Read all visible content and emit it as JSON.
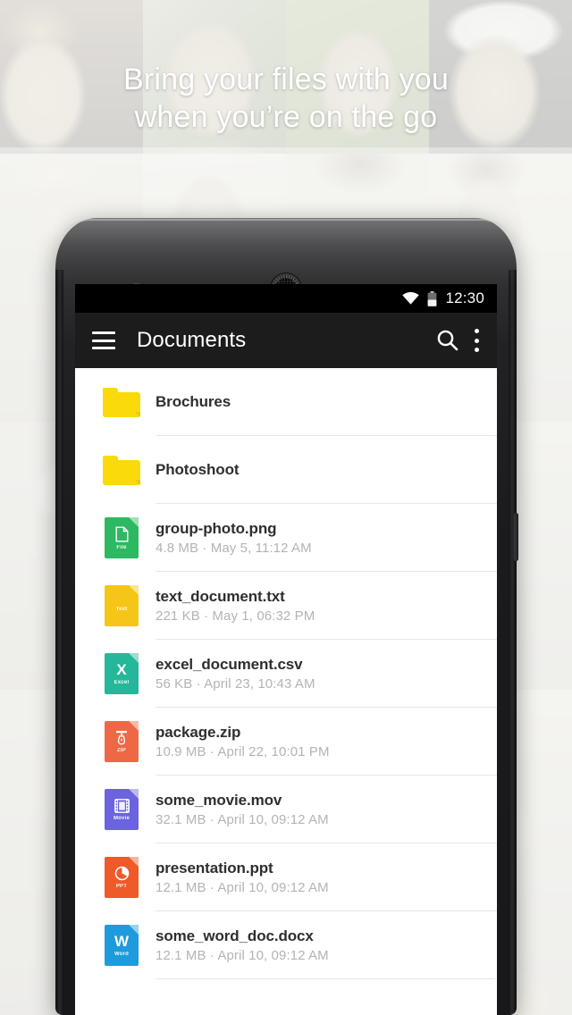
{
  "headline": {
    "line1": "Bring your files with you",
    "line2": "when you’re on the go"
  },
  "device": {
    "camera": "front-camera",
    "speaker": "earpiece-speaker"
  },
  "status_bar": {
    "wifi_icon": "wifi-icon",
    "battery_icon": "battery-icon",
    "time": "12:30"
  },
  "app_bar": {
    "menu_icon": "hamburger-menu-icon",
    "title": "Documents",
    "search_icon": "search-icon",
    "overflow_icon": "overflow-menu-icon"
  },
  "colors": {
    "status_bar_bg": "#000000",
    "app_bar_bg": "#1c1c1c",
    "screen_bg": "#ffffff",
    "folder": "#fada0a",
    "file_png": "#2db862",
    "file_txt": "#f5c518",
    "file_csv": "#25b79a",
    "file_zip": "#ef6845",
    "file_mov": "#6b63e0",
    "file_ppt": "#ef5a2a",
    "file_docx": "#1e9bdc",
    "primary_text": "#2e2e2e",
    "secondary_text": "#b4b4b4",
    "divider": "#e6e6e6"
  },
  "file_list": [
    {
      "type": "folder",
      "icon": "folder-icon",
      "name": "Brochures",
      "meta": ""
    },
    {
      "type": "folder",
      "icon": "folder-icon",
      "name": "Photoshoot",
      "meta": ""
    },
    {
      "type": "file",
      "icon": "file-png-icon",
      "tag": "File",
      "glyph": "page",
      "color": "#2db862",
      "name": "group-photo.png",
      "meta": "4.8 MB · May 5, 11:12 AM"
    },
    {
      "type": "file",
      "icon": "file-txt-icon",
      "tag": "Text",
      "glyph": "lines",
      "color": "#f5c518",
      "name": "text_document.txt",
      "meta": "221 KB · May 1, 06:32 PM"
    },
    {
      "type": "file",
      "icon": "file-csv-icon",
      "tag": "Excel",
      "glyph": "X",
      "color": "#25b79a",
      "name": "excel_document.csv",
      "meta": "56 KB · April 23, 10:43 AM"
    },
    {
      "type": "file",
      "icon": "file-zip-icon",
      "tag": "ZIP",
      "glyph": "zipper",
      "color": "#ef6845",
      "name": "package.zip",
      "meta": "10.9 MB · April 22, 10:01 PM"
    },
    {
      "type": "file",
      "icon": "file-mov-icon",
      "tag": "Movie",
      "glyph": "film",
      "color": "#6b63e0",
      "name": "some_movie.mov",
      "meta": "32.1 MB · April 10, 09:12 AM"
    },
    {
      "type": "file",
      "icon": "file-ppt-icon",
      "tag": "PPT",
      "glyph": "pie",
      "color": "#ef5a2a",
      "name": "presentation.ppt",
      "meta": "12.1 MB · April 10, 09:12 AM"
    },
    {
      "type": "file",
      "icon": "file-docx-icon",
      "tag": "Word",
      "glyph": "W",
      "color": "#1e9bdc",
      "name": "some_word_doc.docx",
      "meta": "12.1 MB · April 10, 09:12 AM"
    }
  ]
}
